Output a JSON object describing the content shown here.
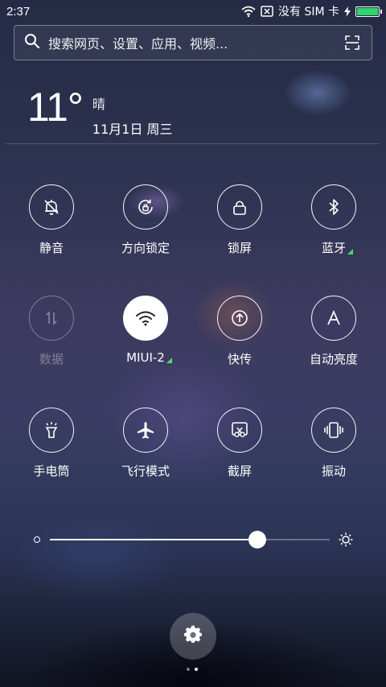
{
  "status_bar": {
    "time": "2:37",
    "carrier": "没有 SIM 卡",
    "battery_level": 1.0,
    "battery_color": "#2fd46a",
    "icons": [
      "wifi-icon",
      "no-sim-icon",
      "charging-icon",
      "battery-icon"
    ]
  },
  "search": {
    "placeholder": "搜索网页、设置、应用、视频...",
    "icons": [
      "search-icon",
      "scan-icon"
    ]
  },
  "weather": {
    "temperature": "11°",
    "condition": "晴",
    "date": "11月1日 周三"
  },
  "toggles": [
    {
      "label": "静音",
      "icon": "bell-off-icon",
      "state": "idle"
    },
    {
      "label": "方向锁定",
      "icon": "rotation-lock-icon",
      "state": "idle"
    },
    {
      "label": "锁屏",
      "icon": "lock-icon",
      "state": "idle"
    },
    {
      "label": "蓝牙",
      "icon": "bluetooth-icon",
      "state": "idle",
      "signal": true
    },
    {
      "label": "数据",
      "icon": "data-arrows-icon",
      "state": "disabled"
    },
    {
      "label": "MIUI-2",
      "icon": "wifi-icon",
      "state": "on",
      "signal": true
    },
    {
      "label": "快传",
      "icon": "upload-icon",
      "state": "idle"
    },
    {
      "label": "自动亮度",
      "icon": "auto-brightness-icon",
      "state": "idle"
    },
    {
      "label": "手电筒",
      "icon": "flashlight-icon",
      "state": "idle"
    },
    {
      "label": "飞行模式",
      "icon": "airplane-icon",
      "state": "idle"
    },
    {
      "label": "截屏",
      "icon": "screenshot-icon",
      "state": "idle"
    },
    {
      "label": "振动",
      "icon": "vibrate-icon",
      "state": "idle"
    }
  ],
  "brightness": {
    "level": 0.74,
    "icons": [
      "brightness-low-icon",
      "brightness-high-icon"
    ]
  },
  "settings": {
    "icon": "gear-icon"
  },
  "pager": {
    "count": 2,
    "active": 1
  },
  "colors": {
    "signal_accent": "#4cd964",
    "toggle_on_bg": "#ffffff"
  }
}
